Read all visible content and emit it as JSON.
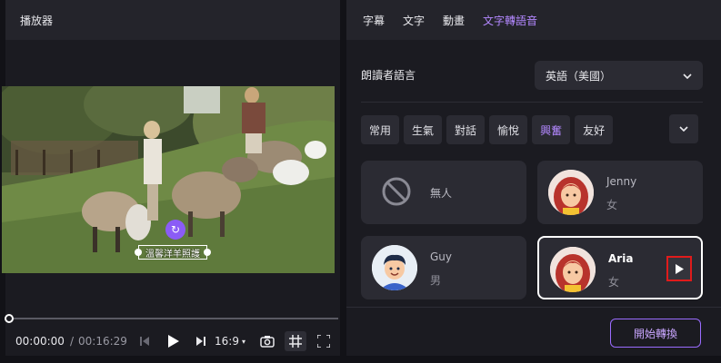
{
  "player": {
    "title": "播放器",
    "caption": "溫馨洋羊照護",
    "current_time": "00:00:00",
    "separator": "/",
    "total_time": "00:16:29",
    "ratio": "16:9"
  },
  "tabs": [
    {
      "label": "字幕"
    },
    {
      "label": "文字"
    },
    {
      "label": "動畫"
    },
    {
      "label": "文字轉語音"
    }
  ],
  "active_tab": "文字轉語音",
  "narrator": {
    "label": "朗讀者語言",
    "selected": "英語（美國）"
  },
  "moods": [
    {
      "label": "常用"
    },
    {
      "label": "生氣"
    },
    {
      "label": "對話"
    },
    {
      "label": "愉悅"
    },
    {
      "label": "興奮"
    },
    {
      "label": "友好"
    }
  ],
  "active_mood": "興奮",
  "voices": [
    {
      "label": "無人"
    },
    {
      "name": "Jenny",
      "gender": "女"
    },
    {
      "name": "Guy",
      "gender": "男"
    },
    {
      "name": "Aria",
      "gender": "女"
    }
  ],
  "start_button": "開始轉換",
  "colors": {
    "accent": "#b388ff",
    "highlight_box": "#e01b1b",
    "panel": "#1b1b21",
    "card": "#2b2b33"
  }
}
